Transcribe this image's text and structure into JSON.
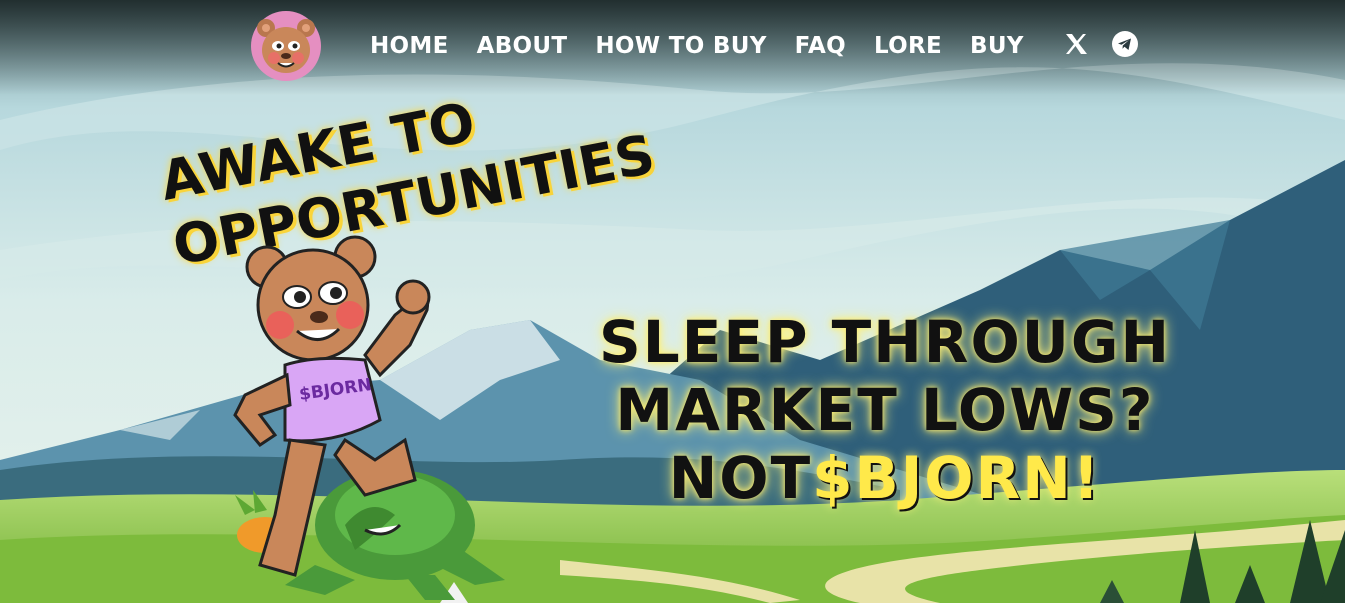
{
  "nav": {
    "items": [
      {
        "label": "HOME"
      },
      {
        "label": "ABOUT"
      },
      {
        "label": "HOW TO BUY"
      },
      {
        "label": "FAQ"
      },
      {
        "label": "LORE"
      },
      {
        "label": "BUY"
      }
    ],
    "social": [
      {
        "icon": "x-icon"
      },
      {
        "icon": "telegram-icon"
      }
    ]
  },
  "hero": {
    "awake_line1": "AWAKE TO",
    "awake_line2": "OPPORTUNITIES",
    "headline_line1": "SLEEP THROUGH",
    "headline_line2": "MARKET LOWS?",
    "headline_line3_prefix": "NOT",
    "headline_line3_accent": "$BJORN!",
    "shirt_text": "$BJORN"
  },
  "colors": {
    "sky_top": "#b9dde6",
    "mountain_dark": "#2f5f7a",
    "grass": "#8cc63f",
    "accent_yellow": "#ffe94a",
    "logo_bg": "#e58fc1"
  }
}
